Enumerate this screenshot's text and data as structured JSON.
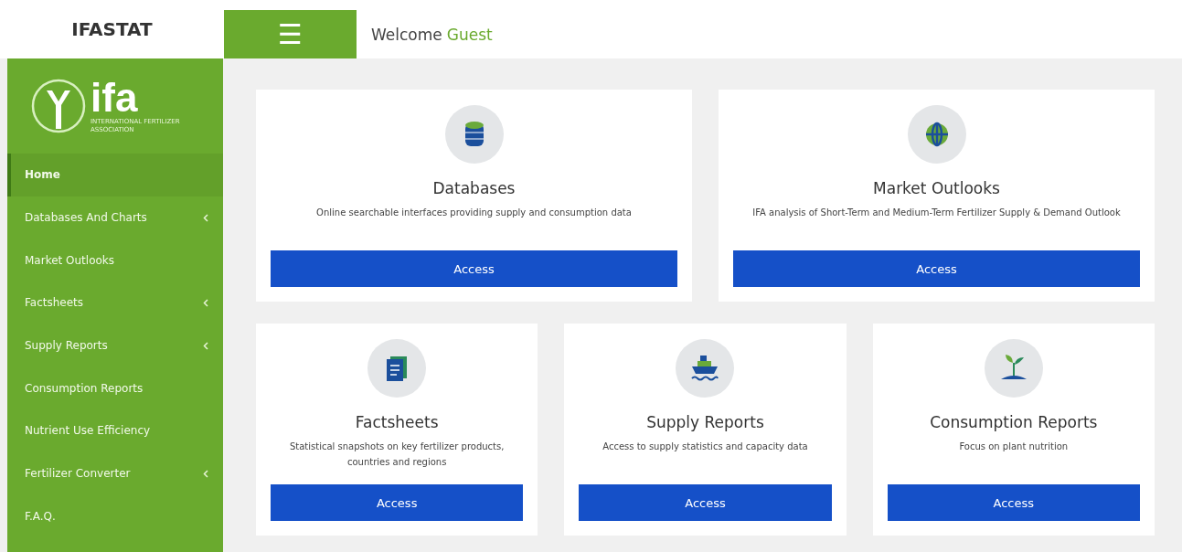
{
  "brand": "IFASTAT",
  "menu_button": "☰",
  "welcome": {
    "text": "Welcome",
    "user": "Guest"
  },
  "logo": {
    "name": "ifa",
    "subtitle": "INTERNATIONAL FERTILIZER ASSOCIATION"
  },
  "sidebar": {
    "items": [
      {
        "label": "Home",
        "selected": true,
        "submenu": false
      },
      {
        "label": "Databases And Charts",
        "selected": false,
        "submenu": true
      },
      {
        "label": "Market Outlooks",
        "selected": false,
        "submenu": false
      },
      {
        "label": "Factsheets",
        "selected": false,
        "submenu": true
      },
      {
        "label": "Supply Reports",
        "selected": false,
        "submenu": true
      },
      {
        "label": "Consumption Reports",
        "selected": false,
        "submenu": false
      },
      {
        "label": "Nutrient Use Efficiency",
        "selected": false,
        "submenu": false
      },
      {
        "label": "Fertilizer Converter",
        "selected": false,
        "submenu": true
      },
      {
        "label": "F.A.Q.",
        "selected": false,
        "submenu": false
      }
    ]
  },
  "cards": [
    {
      "kind": "database",
      "title": "Databases",
      "description": "Online searchable interfaces providing supply and consumption data",
      "button": "Access"
    },
    {
      "kind": "globe",
      "title": "Market Outlooks",
      "description": "IFA analysis of Short-Term and Medium-Term Fertilizer Supply & Demand Outlook",
      "button": "Access"
    },
    {
      "kind": "document",
      "title": "Factsheets",
      "description": "Statistical snapshots on key fertilizer products, countries and regions",
      "button": "Access"
    },
    {
      "kind": "ship",
      "title": "Supply Reports",
      "description": "Access to supply statistics and capacity data",
      "button": "Access"
    },
    {
      "kind": "plant",
      "title": "Consumption Reports",
      "description": "Focus on plant nutrition",
      "button": "Access"
    }
  ]
}
